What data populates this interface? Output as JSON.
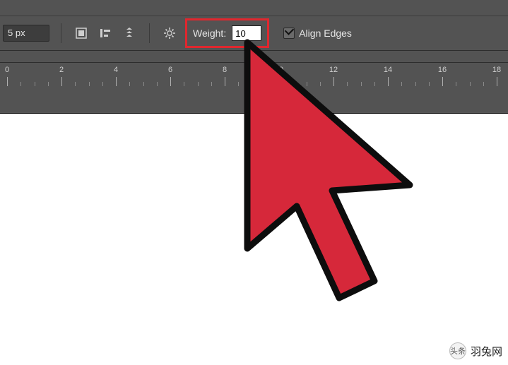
{
  "options_bar": {
    "px_value": "5 px",
    "weight_label": "Weight:",
    "weight_value": "10",
    "align_edges_label": "Align Edges",
    "align_edges_checked": true
  },
  "ruler": {
    "labels": [
      "0",
      "2",
      "4",
      "6",
      "8",
      "10",
      "12",
      "14",
      "16",
      "18"
    ]
  },
  "watermark": {
    "badge": "头条",
    "text": "羽兔网"
  }
}
